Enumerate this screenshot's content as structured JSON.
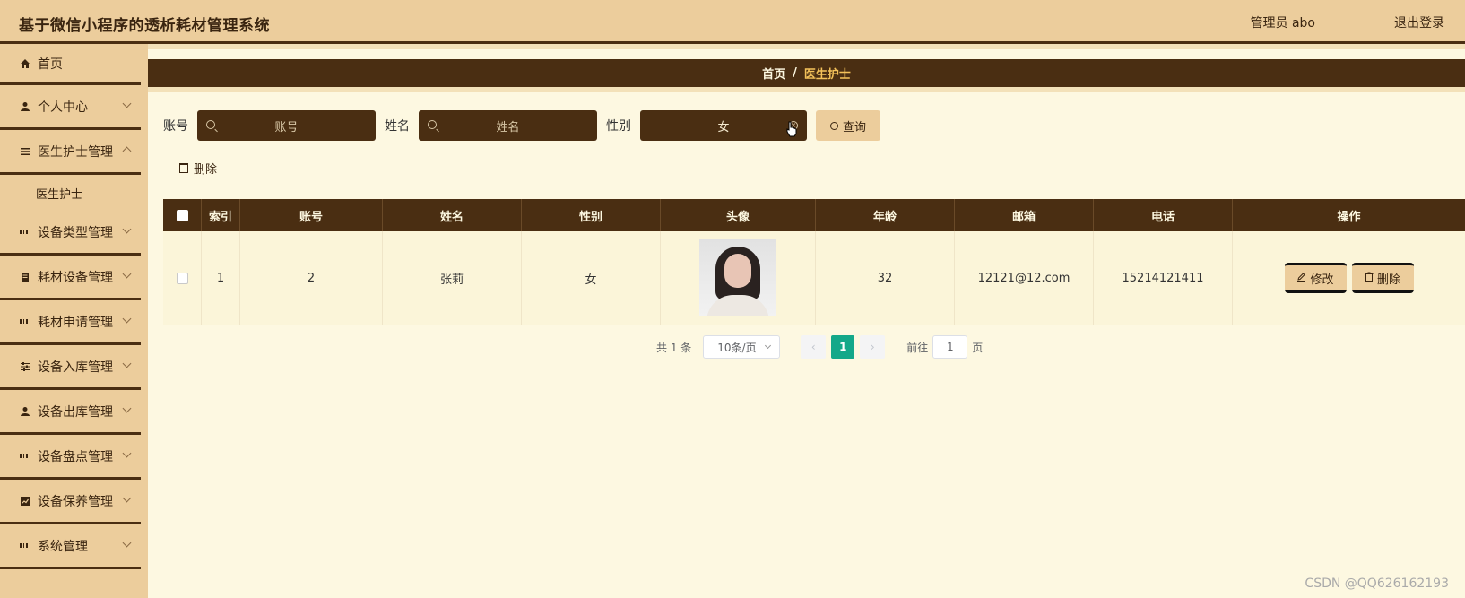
{
  "header": {
    "title": "基于微信小程序的透析耗材管理系统",
    "user": "管理员 abo",
    "logout": "退出登录"
  },
  "sidebar": {
    "items": [
      {
        "label": "首页",
        "icon": "home-icon"
      },
      {
        "label": "个人中心",
        "icon": "user-icon"
      },
      {
        "label": "医生护士管理",
        "icon": "list-icon"
      },
      {
        "label": "医生护士",
        "icon": ""
      },
      {
        "label": "设备类型管理",
        "icon": "grid-icon"
      },
      {
        "label": "耗材设备管理",
        "icon": "document-icon"
      },
      {
        "label": "耗材申请管理",
        "icon": "grid-icon"
      },
      {
        "label": "设备入库管理",
        "icon": "sliders-icon"
      },
      {
        "label": "设备出库管理",
        "icon": "user-icon"
      },
      {
        "label": "设备盘点管理",
        "icon": "grid-icon"
      },
      {
        "label": "设备保养管理",
        "icon": "chart-icon"
      },
      {
        "label": "系统管理",
        "icon": "grid-icon"
      }
    ]
  },
  "breadcrumb": {
    "home": "首页",
    "separator": "/",
    "current": "医生护士"
  },
  "search": {
    "account_label": "账号",
    "account_placeholder": "账号",
    "name_label": "姓名",
    "name_placeholder": "姓名",
    "gender_label": "性别",
    "gender_value": "女",
    "query_button": "查询"
  },
  "toolbar": {
    "delete_label": "删除"
  },
  "table": {
    "headers": [
      "索引",
      "账号",
      "姓名",
      "性别",
      "头像",
      "年龄",
      "邮箱",
      "电话",
      "操作"
    ],
    "rows": [
      {
        "index": "1",
        "account": "2",
        "name": "张莉",
        "gender": "女",
        "age": "32",
        "email": "12121@12.com",
        "phone": "15214121411",
        "edit": "修改",
        "delete": "删除"
      }
    ]
  },
  "pagination": {
    "total": "共 1 条",
    "page_size": "10条/页",
    "current_page": "1",
    "goto_label": "前往",
    "goto_value": "1",
    "page_suffix": "页"
  },
  "watermark": "CSDN @QQ626162193",
  "colors": {
    "dark_brown": "#4a2e12",
    "tan": "#eccd9c",
    "cream": "#fdf8e1",
    "accent_gold": "#f3c15a",
    "page_teal": "#14a889"
  }
}
